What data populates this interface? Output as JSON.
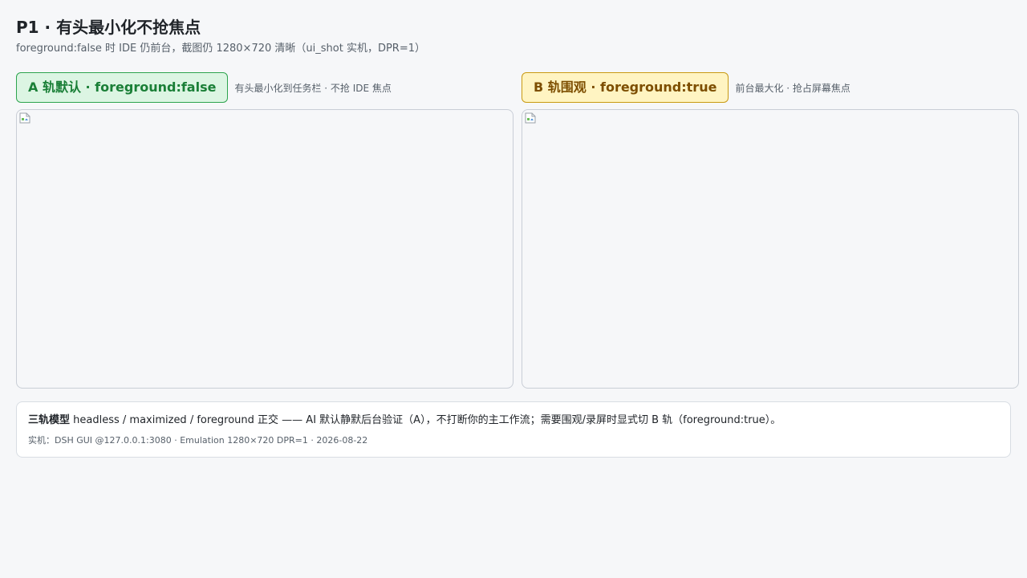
{
  "header": {
    "title": "P1 · 有头最小化不抢焦点",
    "subtitle": "foreground:false 时 IDE 仍前台，截图仍 1280×720 清晰（ui_shot 实机，DPR=1）"
  },
  "tracks": [
    {
      "badge": "A 轨默认 · foreground:false",
      "note": "有头最小化到任务栏 · 不抢 IDE 焦点",
      "accent": "#2da44e"
    },
    {
      "badge": "B 轨围观 · foreground:true",
      "note": "前台最大化 · 抢占屏幕焦点",
      "accent": "#c99a12"
    }
  ],
  "footer": {
    "bold": "三轨模型",
    "text": " headless / maximized / foreground 正交 —— AI 默认静默后台验证（A），不打断你的主工作流；需要围观/录屏时显式切 B 轨（foreground:true）。",
    "meta": "实机：DSH GUI @127.0.0.1:3080 · Emulation 1280×720 DPR=1 · 2026-08-22"
  },
  "icons": {
    "broken_image": "broken-image-icon"
  }
}
